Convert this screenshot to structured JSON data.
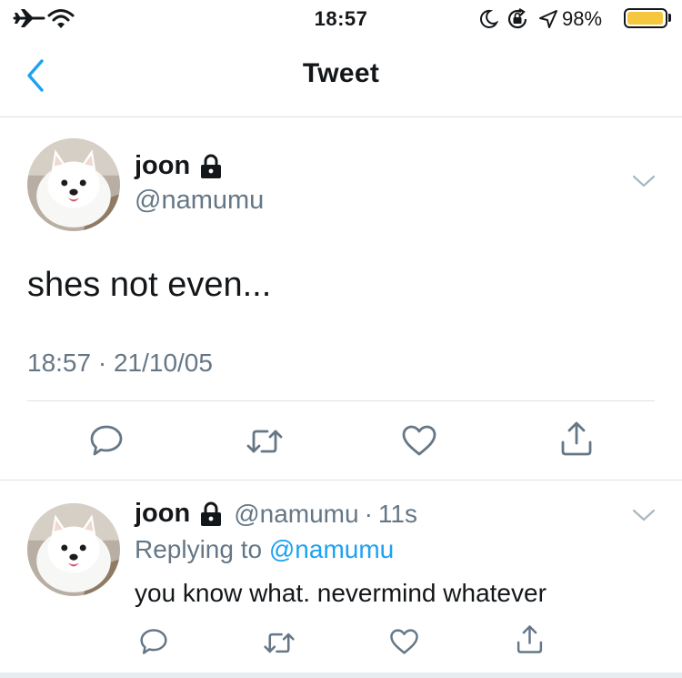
{
  "status_bar": {
    "time": "18:57",
    "battery_text": "98%",
    "battery_level": 0.98,
    "battery_color": "#f5c73f",
    "icons": [
      "airplane-icon",
      "wifi-icon",
      "moon-icon",
      "orientation-lock-icon",
      "location-icon",
      "battery-icon"
    ]
  },
  "nav": {
    "title": "Tweet",
    "back_icon": "chevron-left-icon"
  },
  "main_tweet": {
    "author_name": "joon",
    "author_handle": "@namumu",
    "protected_icon": "lock-icon",
    "text": "shes not even...",
    "timestamp": "18:57 · 21/10/05",
    "menu_icon": "chevron-down-icon",
    "actions": [
      "reply-icon",
      "retweet-icon",
      "like-icon",
      "share-icon"
    ]
  },
  "reply_tweet": {
    "author_name": "joon",
    "author_handle": "@namumu",
    "separator": "·",
    "time_ago": "11s",
    "replying_prefix": "Replying to",
    "replying_to": "@namumu",
    "text": "you know what. nevermind whatever",
    "menu_icon": "chevron-down-icon",
    "actions": [
      "reply-icon",
      "retweet-icon",
      "like-icon",
      "share-icon"
    ]
  },
  "colors": {
    "accent": "#1da1f2",
    "text": "#14171a",
    "muted": "#657786",
    "divider": "#dce0e3"
  }
}
